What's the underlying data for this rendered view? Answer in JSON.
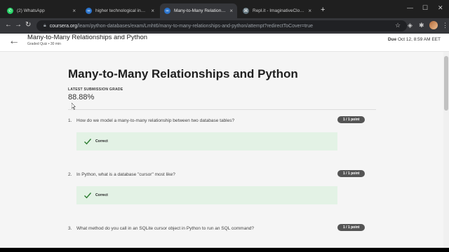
{
  "browser": {
    "tabs": [
      {
        "label": "(2) WhatsApp",
        "icon": "whatsapp-icon",
        "active": false
      },
      {
        "label": "higher technological institute | C",
        "icon": "coursera-icon",
        "active": false
      },
      {
        "label": "Many-to-Many Relationships and",
        "icon": "coursera-icon",
        "active": true
      },
      {
        "label": "Repl.it - ImaginativeCloudyComp",
        "icon": "replit-icon",
        "active": false
      }
    ],
    "new_tab": "+",
    "url_host": "coursera.org",
    "url_path": "/learn/python-databases/exam/Lmht6/many-to-many-relationships-and-python/attempt?redirectToCover=true"
  },
  "header": {
    "title": "Many-to-Many Relationships and Python",
    "subtitle": "Graded Quiz • 30 min",
    "due_label": "Due",
    "due_value": "Oct 12, 8:59 AM EET"
  },
  "main": {
    "title": "Many-to-Many Relationships and Python",
    "grade_label": "LATEST SUBMISSION GRADE",
    "grade_value": "88.88%"
  },
  "questions": [
    {
      "num": "1.",
      "text": "How do we model a many-to-many relationship between two database tables?",
      "points": "1 / 1 point",
      "feedback": "Correct"
    },
    {
      "num": "2.",
      "text": "In Python, what is a database \"cursor\" most like?",
      "points": "1 / 1 point",
      "feedback": "Correct"
    },
    {
      "num": "3.",
      "text": "What method do you call in an SQLite cursor object in Python to run an SQL command?",
      "points": "1 / 1 point",
      "feedback": ""
    }
  ],
  "colors": {
    "accent_green": "#2e7d32",
    "feedback_bg": "#e3f2e5",
    "points_badge": "#555555"
  }
}
